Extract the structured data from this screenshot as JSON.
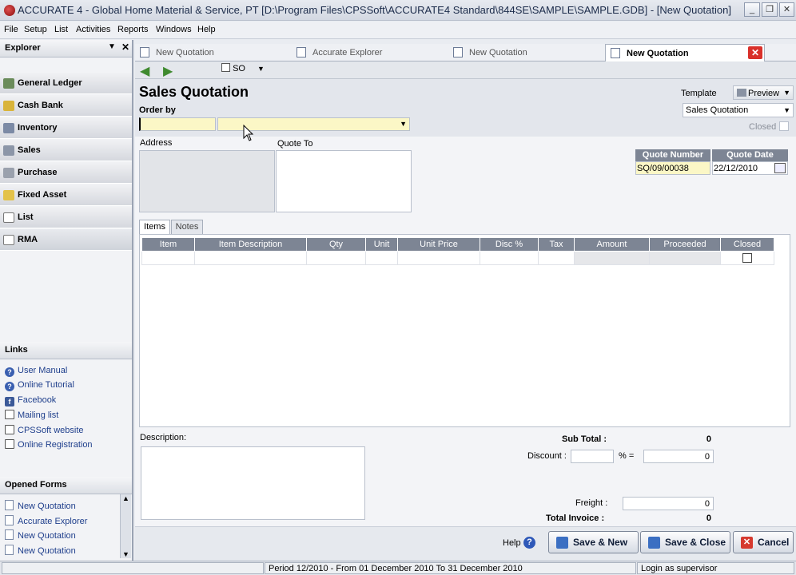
{
  "window": {
    "title": "ACCURATE 4  - Global Home Material & Service, PT  [D:\\Program Files\\CPSSoft\\ACCURATE4 Standard\\844SE\\SAMPLE\\SAMPLE.GDB] - [New Quotation]"
  },
  "menu": [
    "File",
    "Setup",
    "List",
    "Activities",
    "Reports",
    "Windows",
    "Help"
  ],
  "explorer": {
    "title": "Explorer",
    "items": [
      "General Ledger",
      "Cash Bank",
      "Inventory",
      "Sales",
      "Purchase",
      "Fixed Asset",
      "List",
      "RMA"
    ]
  },
  "links": {
    "title": "Links",
    "items": [
      "User Manual",
      "Online Tutorial",
      "Facebook",
      "Mailing list",
      "CPSSoft website",
      "Online Registration"
    ]
  },
  "opened_forms": {
    "title": "Opened Forms",
    "items": [
      "New Quotation",
      "Accurate Explorer",
      "New Quotation",
      "New Quotation"
    ]
  },
  "tabs": [
    "New Quotation",
    "Accurate Explorer",
    "New Quotation",
    "New Quotation"
  ],
  "toolbar": {
    "so_label": "SO"
  },
  "form": {
    "title": "Sales Quotation",
    "order_by_label": "Order by",
    "template_label": "Template",
    "preview_label": "Preview",
    "template_value": "Sales Quotation",
    "closed_label": "Closed",
    "address_label": "Address",
    "quote_to_label": "Quote To",
    "quote_number_label": "Quote Number",
    "quote_number": "SQ/09/00038",
    "quote_date_label": "Quote Date",
    "quote_date": "22/12/2010",
    "subtab_items": "Items",
    "subtab_notes": "Notes",
    "columns": [
      "Item",
      "Item Description",
      "Qty",
      "Unit",
      "Unit Price",
      "Disc %",
      "Tax",
      "Amount",
      "Proceeded",
      "Closed"
    ],
    "description_label": "Description:",
    "sub_total_label": "Sub Total :",
    "sub_total": "0",
    "discount_label": "Discount :",
    "percent_label": "% =",
    "discount_value": "0",
    "freight_label": "Freight :",
    "freight_value": "0",
    "total_invoice_label": "Total Invoice :",
    "total_invoice": "0"
  },
  "buttons": {
    "help": "Help",
    "save_new": "Save & New",
    "save_close": "Save & Close",
    "cancel": "Cancel"
  },
  "status": {
    "period": "Period 12/2010 - From 01 December 2010 To 31 December 2010",
    "login": "Login as supervisor"
  }
}
